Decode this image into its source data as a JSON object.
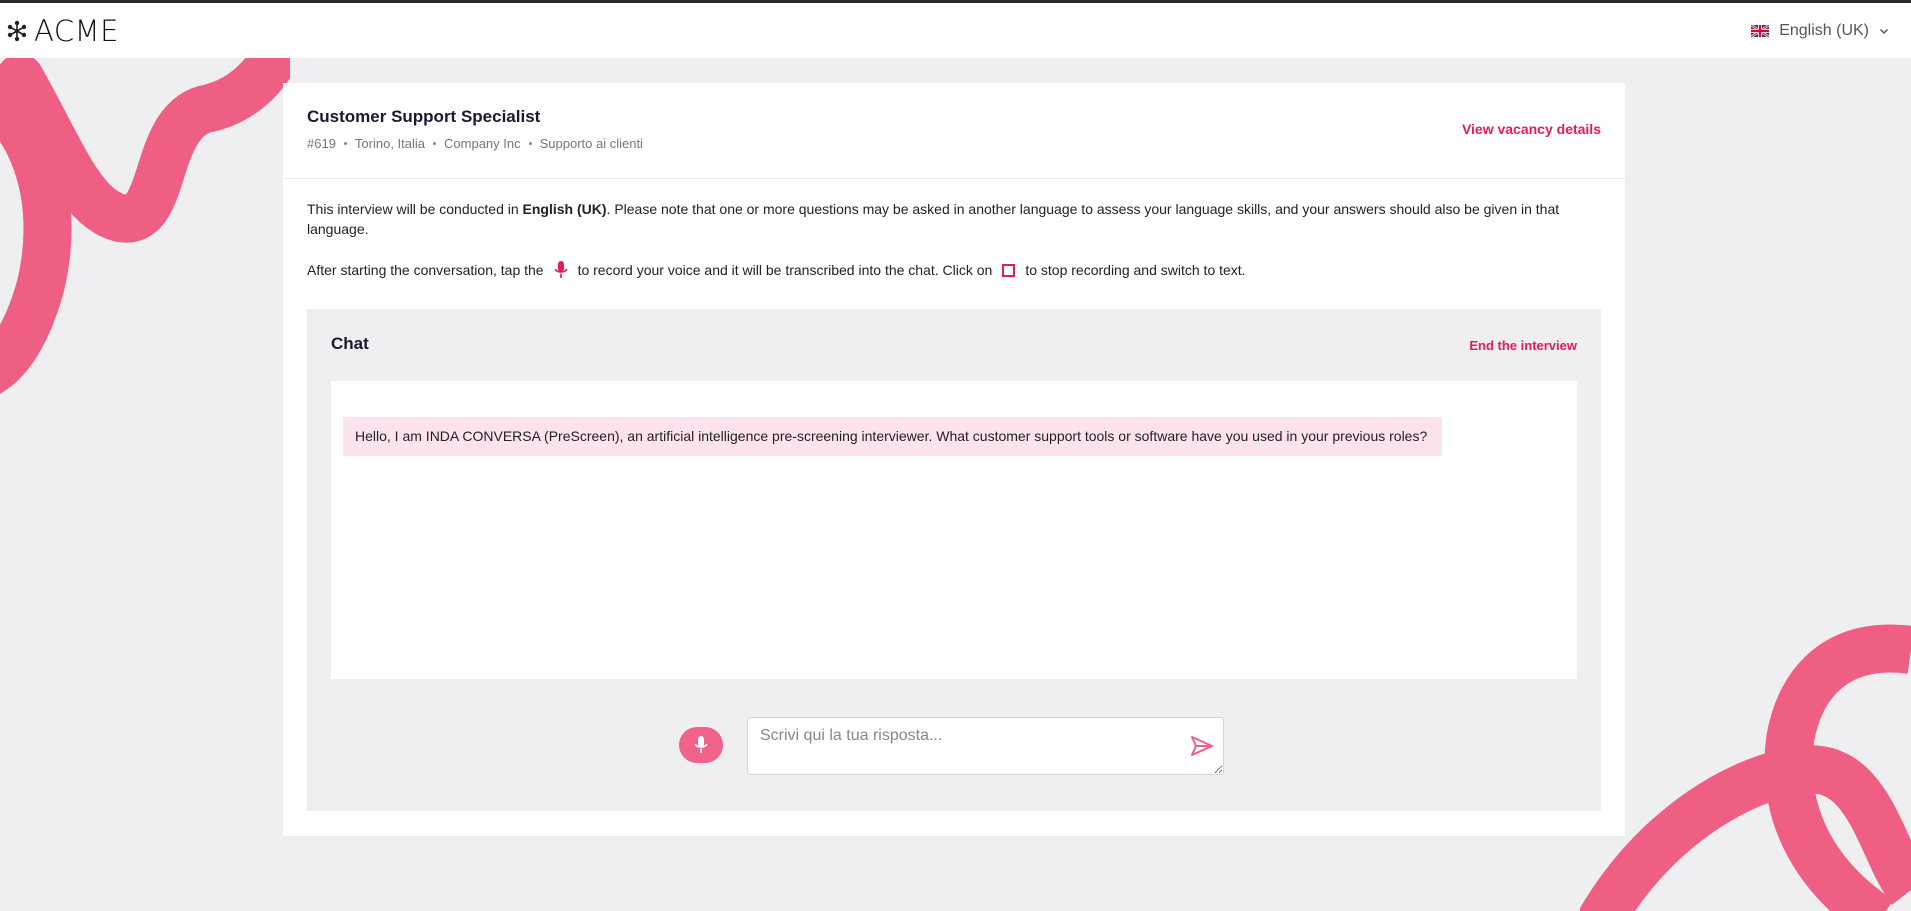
{
  "brand": {
    "name": "ACME"
  },
  "language": {
    "label": "English (UK)"
  },
  "vacancy": {
    "title": "Customer Support Specialist",
    "id": "#619",
    "location": "Torino, Italia",
    "company": "Company Inc",
    "department": "Supporto ai clienti",
    "view_details_label": "View vacancy details"
  },
  "intro": {
    "line1_pre": "This interview will be conducted in ",
    "line1_lang": "English (UK)",
    "line1_post": ". Please note that one or more questions may be asked in another language to assess your language skills, and your answers should also be given in that language.",
    "line2_a": "After starting the conversation, tap the",
    "line2_b": "to record your voice and it will be transcribed into the chat. Click on",
    "line2_c": "to stop recording and switch to text."
  },
  "chat": {
    "title": "Chat",
    "end_label": "End the interview",
    "messages": [
      {
        "sender": "bot",
        "text": "Hello, I am INDA CONVERSA (PreScreen), an artificial intelligence pre-screening interviewer. What customer support tools or software have you used in your previous roles?"
      }
    ],
    "input_placeholder": "Scrivi qui la tua risposta..."
  },
  "icons": {
    "logo": "molecule-icon",
    "flag": "uk-flag-icon",
    "chevron": "chevron-down-icon",
    "mic": "microphone-icon",
    "stop": "stop-square-icon",
    "send": "send-icon"
  },
  "colors": {
    "accent": "#e11d5a",
    "accent_soft": "#f0628a",
    "bubble": "#fde4ea",
    "background": "#efeff1",
    "decor": "#ef5f84"
  }
}
